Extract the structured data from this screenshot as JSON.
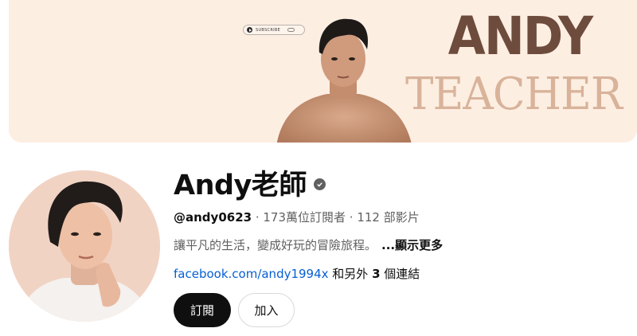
{
  "banner": {
    "subscribe_text": "SUBSCRIBE",
    "title_line1": "ANDY",
    "title_line2": "TEACHER",
    "background_color": "#fdeee2",
    "title1_color": "#6d4b3d",
    "title2_color": "#d8b39a"
  },
  "channel": {
    "name": "Andy老師",
    "verified_icon": "check-circle-icon",
    "handle": "@andy0623",
    "subscribers": "173萬位訂閱者",
    "videos": "112 部影片",
    "separator": " · ",
    "description": "讓平凡的生活，變成好玩的冒險旅程。",
    "show_more": "...顯示更多",
    "link_url": "facebook.com/andy1994x",
    "link_suffix_prefix": " 和另外 ",
    "link_count": "3",
    "link_suffix_end": " 個連結",
    "link_color": "#065fd4"
  },
  "actions": {
    "subscribe_label": "訂閱",
    "join_label": "加入"
  }
}
